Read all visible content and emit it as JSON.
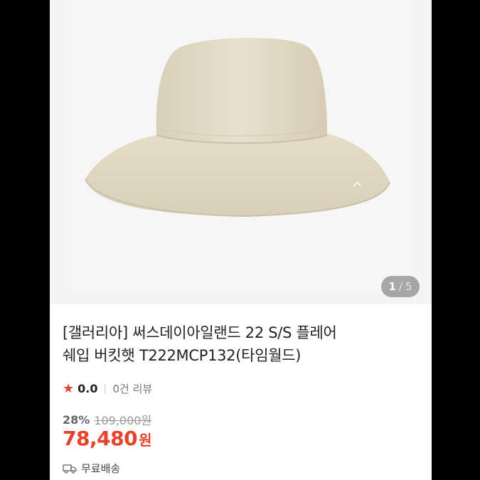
{
  "gallery": {
    "current": "1",
    "separator": "/",
    "total": "5"
  },
  "product": {
    "title_line1": "[갤러리아] 써스데이아일랜드 22 S/S 플레어",
    "title_line2": "쉐입 버킷햇 T222MCP132(타임월드)",
    "rating": "0.0",
    "review_count": "0건 리뷰",
    "discount": "28%",
    "original_price": "109,000원",
    "price": "78,480",
    "currency": "원",
    "shipping": "무료배송"
  },
  "icons": {
    "rating": "star-icon",
    "shipping": "truck-icon"
  },
  "colors": {
    "accent": "#e8412c",
    "hat": "#e4dcc7"
  }
}
